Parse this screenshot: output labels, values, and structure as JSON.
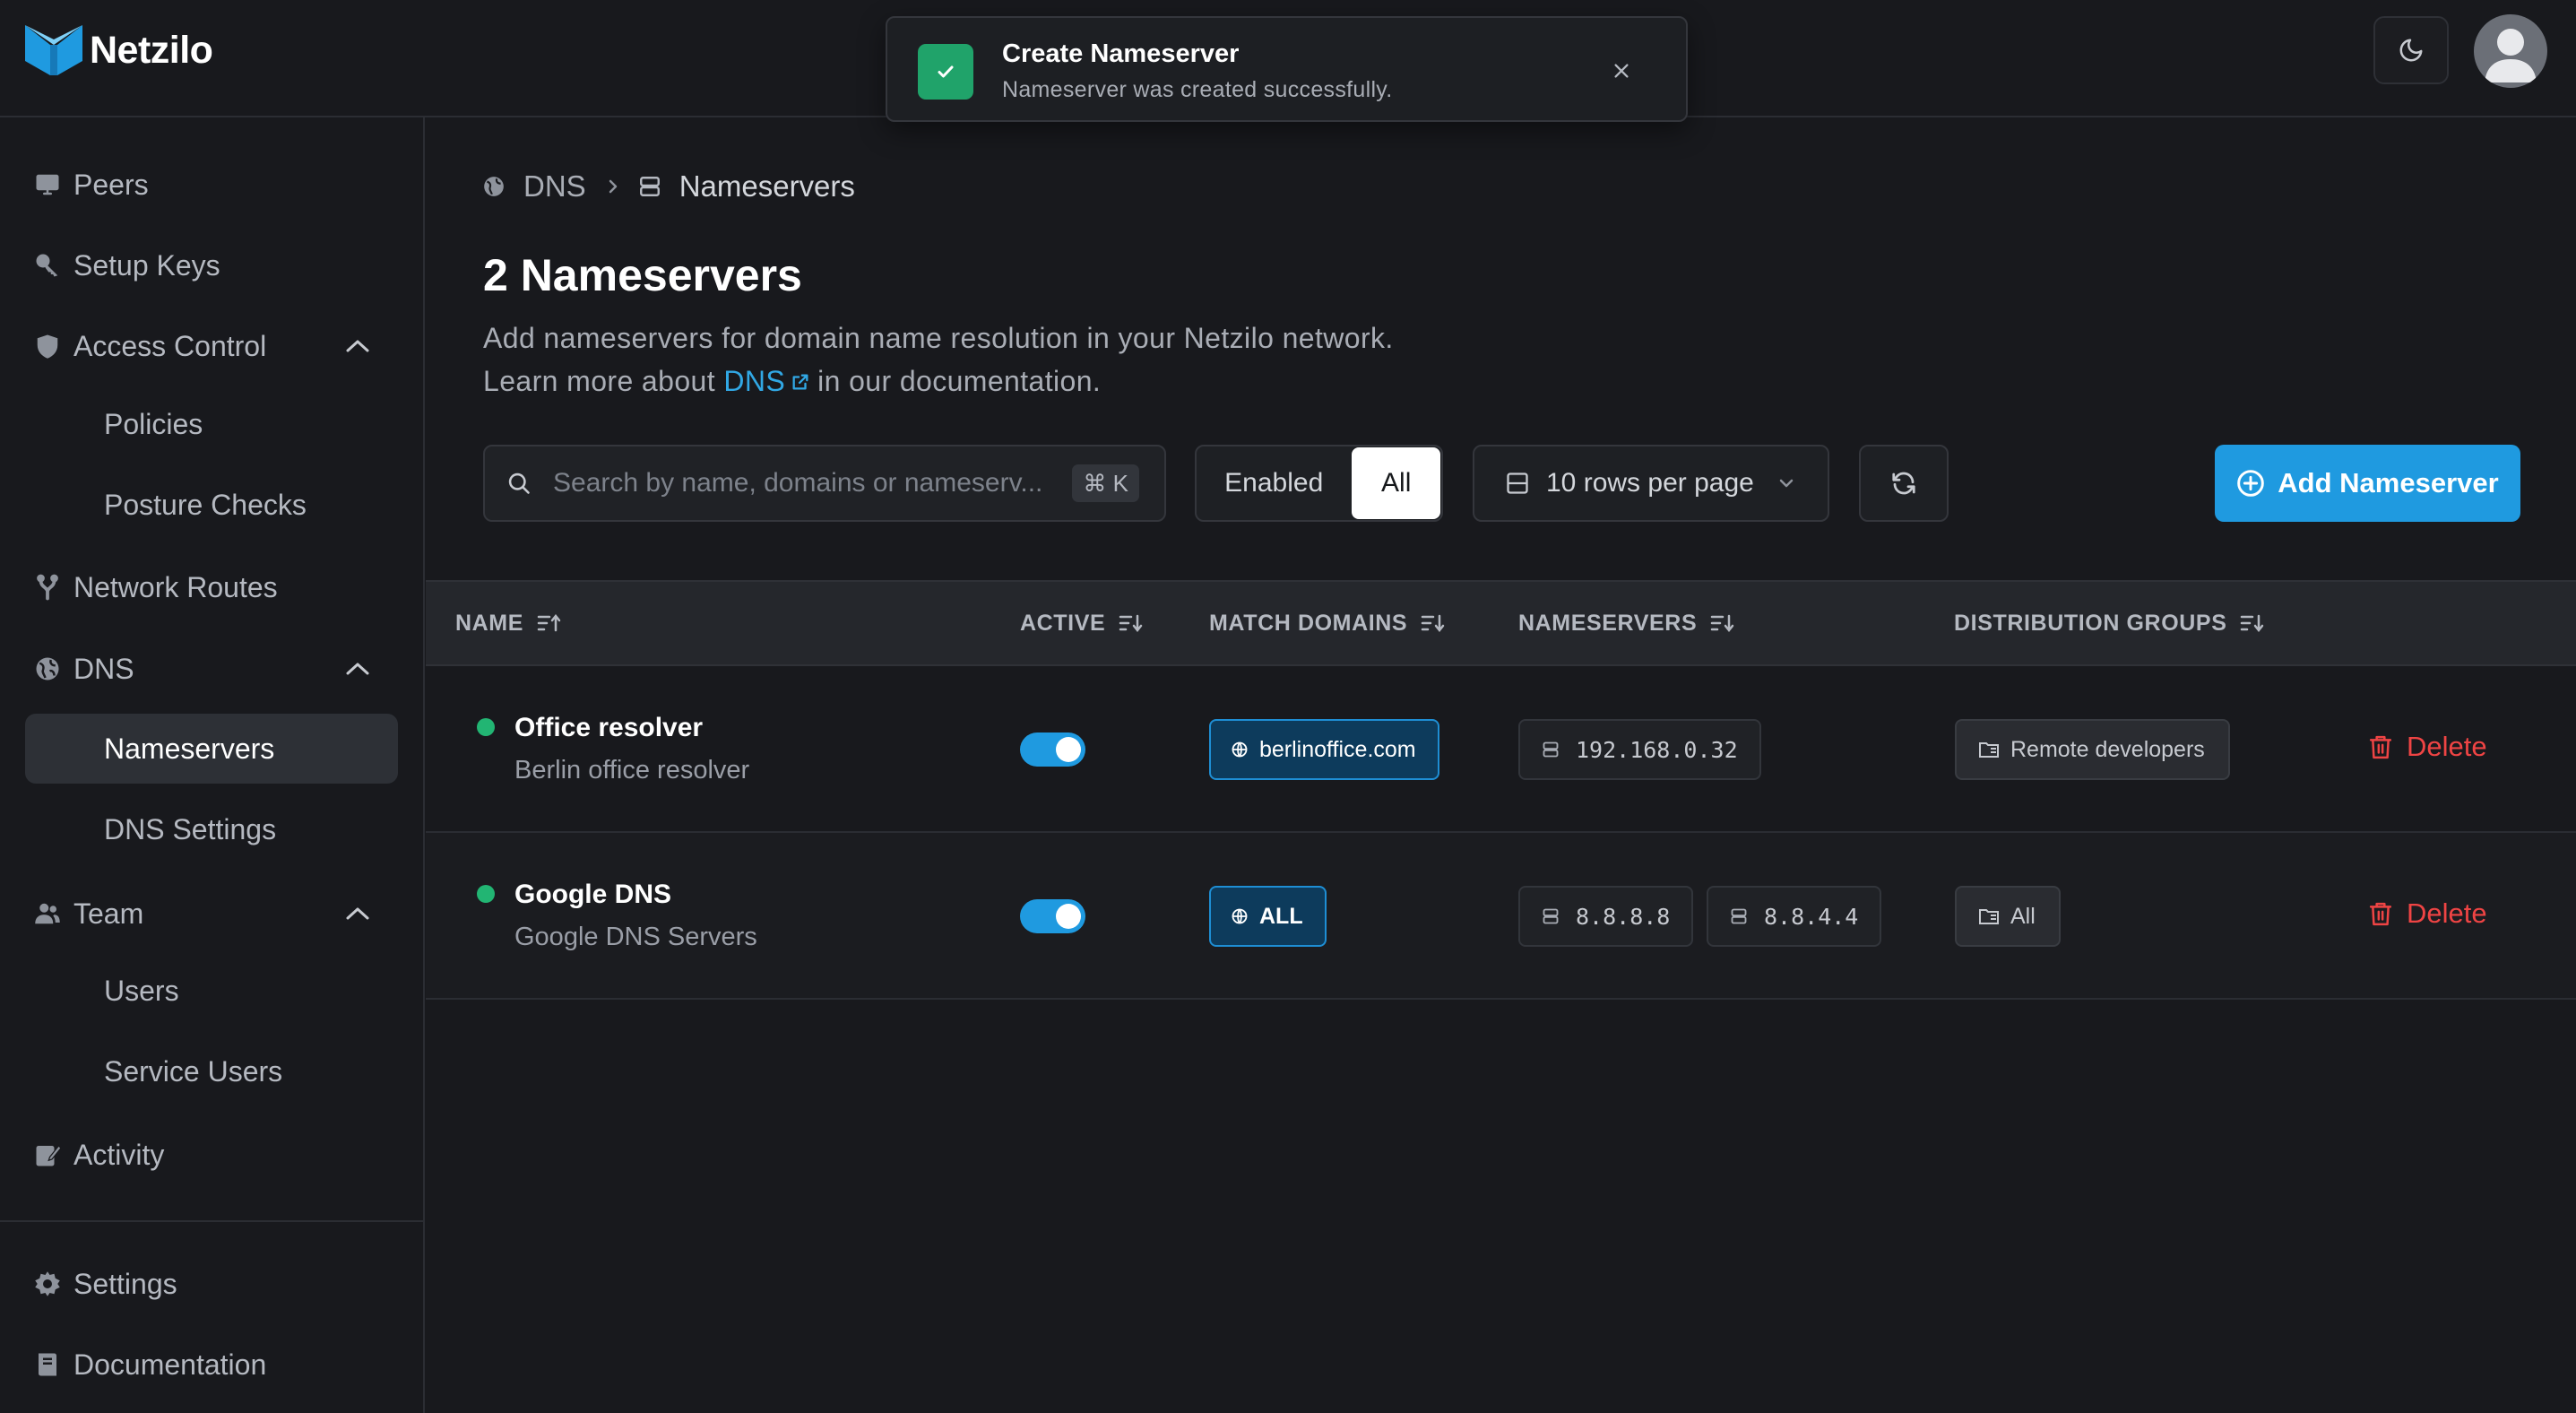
{
  "app": {
    "name": "Netzilo"
  },
  "toast": {
    "title": "Create Nameserver",
    "message": "Nameserver was created successfully."
  },
  "sidebar": {
    "items": [
      {
        "label": "Peers",
        "icon": "monitor-icon"
      },
      {
        "label": "Setup Keys",
        "icon": "key-icon"
      },
      {
        "label": "Access Control",
        "icon": "shield-icon"
      },
      {
        "label": "Policies"
      },
      {
        "label": "Posture Checks"
      },
      {
        "label": "Network Routes",
        "icon": "route-icon"
      },
      {
        "label": "DNS",
        "icon": "globe-icon"
      },
      {
        "label": "Nameservers"
      },
      {
        "label": "DNS Settings"
      },
      {
        "label": "Team",
        "icon": "users-icon"
      },
      {
        "label": "Users"
      },
      {
        "label": "Service Users"
      },
      {
        "label": "Activity",
        "icon": "activity-icon"
      },
      {
        "label": "Settings",
        "icon": "gear-icon"
      },
      {
        "label": "Documentation",
        "icon": "book-icon"
      }
    ]
  },
  "breadcrumb": {
    "parent": "DNS",
    "current": "Nameservers"
  },
  "page": {
    "title": "2 Nameservers",
    "description": "Add nameservers for domain name resolution in your Netzilo network.",
    "learn_prefix": "Learn more about",
    "learn_link": "DNS",
    "learn_suffix": "in our documentation."
  },
  "toolbar": {
    "search_placeholder": "Search by name, domains or nameserv...",
    "search_shortcut": "⌘ K",
    "filter_enabled": "Enabled",
    "filter_all": "All",
    "rows_per_page": "10 rows per page",
    "add_label": "Add Nameserver"
  },
  "table": {
    "columns": [
      "NAME",
      "ACTIVE",
      "MATCH DOMAINS",
      "NAMESERVERS",
      "DISTRIBUTION GROUPS"
    ],
    "rows": [
      {
        "name": "Office resolver",
        "description": "Berlin office resolver",
        "active": true,
        "match_domain": "berlinoffice.com",
        "nameservers": [
          "192.168.0.32"
        ],
        "group": "Remote developers",
        "delete_label": "Delete"
      },
      {
        "name": "Google DNS",
        "description": "Google DNS Servers",
        "active": true,
        "match_domain": "ALL",
        "nameservers": [
          "8.8.8.8",
          "8.8.4.4"
        ],
        "group": "All",
        "delete_label": "Delete"
      }
    ]
  },
  "colors": {
    "accent": "#1f9ae0",
    "success": "#20a36a",
    "danger": "#ef4444",
    "background": "#18191d"
  }
}
